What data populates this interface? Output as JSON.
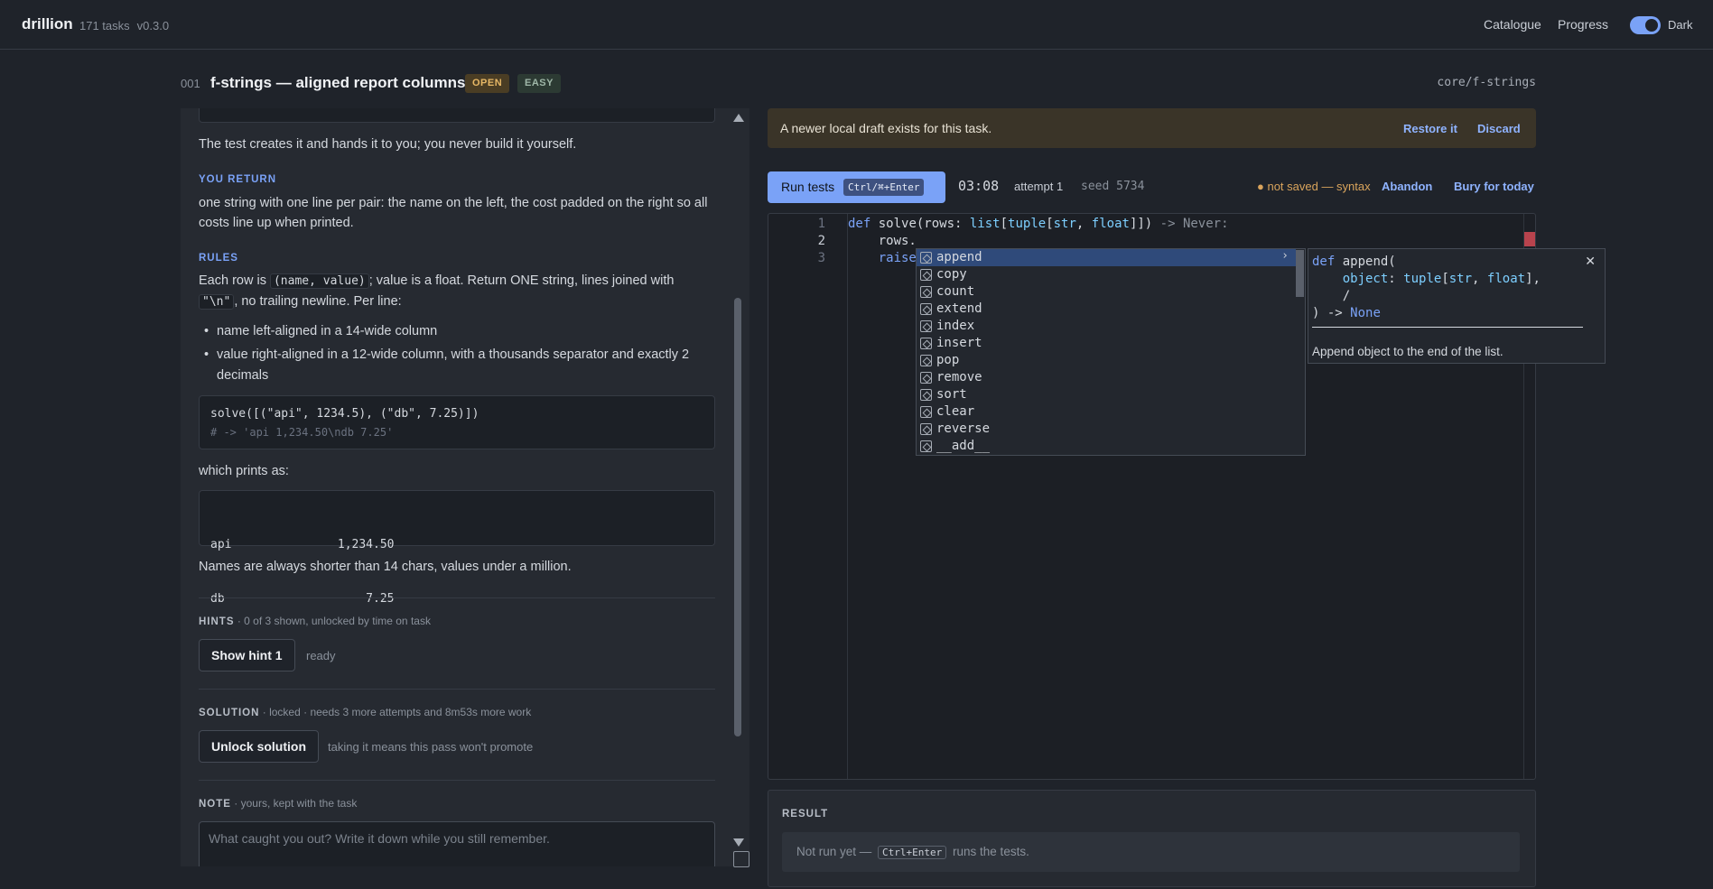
{
  "app": {
    "name": "drillion",
    "task_count": "171 tasks",
    "version": "v0.3.0"
  },
  "nav": {
    "catalogue": "Catalogue",
    "progress": "Progress",
    "theme_label": "Dark",
    "theme_on": true
  },
  "task": {
    "number": "001",
    "title": "f-strings — aligned report columns",
    "status_badge": "OPEN",
    "difficulty_badge": "EASY",
    "path": "core/f-strings"
  },
  "left": {
    "intro": "The test creates it and hands it to you; you never build it yourself.",
    "you_return_label": "YOU RETURN",
    "you_return_text": "one string with one line per pair: the name on the left, the cost padded on the right so all costs line up when printed.",
    "rules_label": "RULES",
    "rules_p1_a": "Each row is ",
    "rules_p1_code1": "(name, value)",
    "rules_p1_b": "; value is a float. Return ONE string, lines joined with",
    "rules_p1_code2": "\"\\n\"",
    "rules_p1_c": ", no trailing newline. Per line:",
    "bullets": [
      "name left-aligned in a 14-wide column",
      "value right-aligned in a 12-wide column, with a thousands separator and exactly 2 decimals"
    ],
    "example_call": "solve([(\"api\", 1234.5), (\"db\", 7.25)])",
    "example_comment": "# -> 'api              1,234.50\\ndb                   7.25'",
    "prints_as": "which prints as:",
    "output_lines": [
      "api               1,234.50",
      "db                    7.25"
    ],
    "names_note": "Names are always shorter than 14 chars, values under a million.",
    "hints_label": "HINTS",
    "hints_meta": " · 0 of 3 shown, unlocked by time on task",
    "show_hint_button": "Show hint 1",
    "hint_status": "ready",
    "solution_label": "SOLUTION",
    "solution_meta": " · locked · needs 3 more attempts and 8m53s more work",
    "unlock_button": "Unlock solution",
    "unlock_note": "taking it means this pass won't promote",
    "note_label": "NOTE",
    "note_meta": " · yours, kept with the task",
    "note_placeholder": "What caught you out? Write it down while you still remember."
  },
  "draft": {
    "message": "A newer local draft exists for this task.",
    "restore": "Restore it",
    "discard": "Discard"
  },
  "toolbar": {
    "run_label": "Run tests",
    "run_shortcut": "Ctrl/⌘+Enter",
    "timer": "03:08",
    "attempt": "attempt 1",
    "seed": "seed 5734",
    "save_status": "● not saved — syntax",
    "abandon": "Abandon",
    "bury": "Bury for today"
  },
  "editor": {
    "line_numbers": [
      "1",
      "2",
      "3"
    ],
    "line1": {
      "def": "def",
      "name": " solve(rows: ",
      "list": "list",
      "b1": "[",
      "tuple": "tuple",
      "b2": "[",
      "str": "str",
      "comma": ", ",
      "float": "float",
      "close": "]])",
      "arrow": " -> Never:"
    },
    "line2": "    rows.",
    "line3": "    raise"
  },
  "autocomplete": {
    "items": [
      "append",
      "copy",
      "count",
      "extend",
      "index",
      "insert",
      "pop",
      "remove",
      "sort",
      "clear",
      "reverse",
      "__add__"
    ],
    "selected": "append"
  },
  "doc": {
    "sig1_def": "def",
    "sig1_rest": " append(",
    "sig2_param": "    object",
    "sig2_colon": ": ",
    "sig2_tuple": "tuple",
    "sig2_b": "[",
    "sig2_str": "str",
    "sig2_comma": ", ",
    "sig2_float": "float",
    "sig2_end": "],",
    "sig3": "    /",
    "sig4_a": ") -> ",
    "sig4_none": "None",
    "description": "Append object to the end of the list."
  },
  "result": {
    "label": "RESULT",
    "text_a": "Not run yet — ",
    "shortcut": "Ctrl+Enter",
    "text_b": " runs the tests."
  },
  "colors": {
    "accent": "#7aa2f7",
    "warn": "#d9a45c",
    "draft_bg": "#3a3428"
  }
}
